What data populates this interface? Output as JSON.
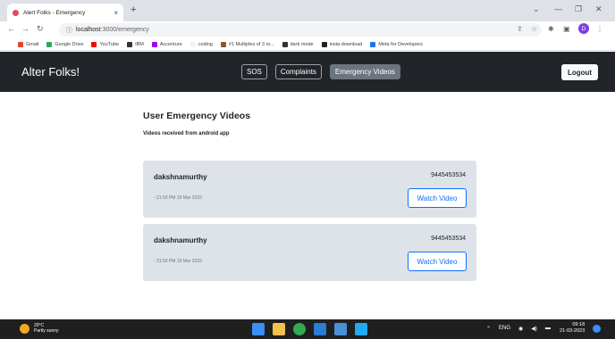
{
  "browser": {
    "tab_title": "Alert Folks - Emergency",
    "tab_close": "×",
    "new_tab": "+",
    "url_host": "localhost",
    "url_path": ":3000/emergency",
    "bookmarks": [
      {
        "label": "Gmail",
        "color": "#ea4335"
      },
      {
        "label": "Google Drive",
        "color": "#34a853"
      },
      {
        "label": "YouTube",
        "color": "#ff0000"
      },
      {
        "label": "IBM",
        "color": "#333333"
      },
      {
        "label": "Accenture",
        "color": "#a100ff"
      },
      {
        "label": "coding",
        "color": "#f1f3f4"
      },
      {
        "label": "#1 Multiples of 3 or...",
        "color": "#8b5a2b"
      },
      {
        "label": "dark mode",
        "color": "#333333"
      },
      {
        "label": "insta download",
        "color": "#222222"
      },
      {
        "label": "Meta for Developers",
        "color": "#1877f2"
      }
    ],
    "profile_initial": "D"
  },
  "nav": {
    "brand": "Alter Folks!",
    "links": [
      {
        "label": "SOS",
        "active": false
      },
      {
        "label": "Complaints",
        "active": false
      },
      {
        "label": "Emergency Videos",
        "active": true
      }
    ],
    "logout": "Logout"
  },
  "page": {
    "title": "User Emergency Videos",
    "subtitle": "Videos received from android app"
  },
  "videos": [
    {
      "name": "dakshnamurthy",
      "phone": "9445453534",
      "time": "- 21:50 PM 19 Mar 2023",
      "button": "Watch Video"
    },
    {
      "name": "dakshnamurthy",
      "phone": "9445453534",
      "time": "- 21:50 PM 19 Mar 2023",
      "button": "Watch Video"
    }
  ],
  "taskbar": {
    "temp": "29°C",
    "weather": "Partly sunny",
    "lang": "ENG",
    "time": "09:18",
    "date": "21-03-2023"
  }
}
